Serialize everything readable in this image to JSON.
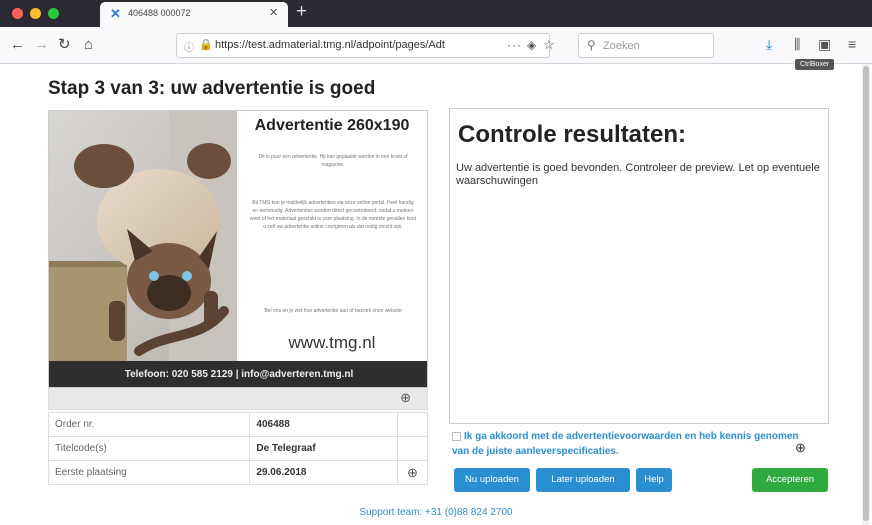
{
  "browser": {
    "tab_title": "406488 000072",
    "tab_close": "×",
    "new_tab": "+",
    "url": "https://test.admaterial.tmg.nl/adpoint/pages/Adt",
    "url_more": "···",
    "search_placeholder": "Zoeken",
    "tooltip": "CtrlBoxer",
    "nav": {
      "back": "←",
      "forward": "→",
      "reload": "↻",
      "home": "⌂"
    },
    "icons": {
      "tab": "x-logo-icon",
      "info": "info-icon",
      "lock": "lock-icon",
      "pocket": "pocket-icon",
      "star": "bookmark-star-icon",
      "search": "search-icon",
      "download": "download-icon",
      "library": "library-icon",
      "sidebar": "sidebar-icon",
      "menu": "hamburger-menu-icon"
    }
  },
  "page": {
    "title": "Stap 3 van 3: uw advertentie is goed",
    "ad_preview": {
      "heading": "Advertentie 260x190",
      "paragraph_1": "Dit is puur een advertentie. Hij kan geplaatst worden in een krant of magazine.",
      "paragraph_2": "Bij TMG kun je makkelijk advertenties via onze online portal. Heel handig en eenvoudig. Advertenties worden direct gecontroleerd, zodat u meteen weet of het materiaal geschikt is voor plaatsing. In de meeste gevallen kunt u zelf uw advertentie online corrigeren als dat nodig mocht zijn.",
      "paragraph_3": "Bel ons en je ziet hoe advertentie aan of bezoek onze website",
      "website": "www.tmg.nl",
      "footer": "Telefoon: 020 585 2129 | info@adverteren.tmg.nl"
    },
    "table": [
      {
        "label": "Order nr.",
        "value": "406488",
        "action": ""
      },
      {
        "label": "Titelcode(s)",
        "value": "De Telegraaf",
        "action": ""
      },
      {
        "label": "Eerste plaatsing",
        "value": "29.06.2018",
        "action": "⊕"
      }
    ],
    "result": {
      "title": "Controle resultaten:",
      "text": "Uw advertentie is goed bevonden. Controleer de preview. Let op eventuele waarschuwingen"
    },
    "agree_text": "Ik ga akkoord met de advertentievoorwaarden en heb kennis genomen van de juiste aanleverspecificaties.",
    "buttons": {
      "upload_now": "Nu uploaden",
      "upload_later": "Later uploaden",
      "help": "Help",
      "accept": "Accepteren"
    },
    "support": "Support team: +31 (0)88 824 2700",
    "colors": {
      "accent_blue": "#2a8fd0",
      "accept_green": "#2eaa3f",
      "footer_dark": "#2e2e2e"
    }
  }
}
